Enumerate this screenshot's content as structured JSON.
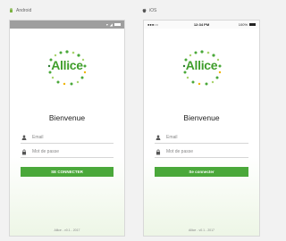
{
  "platforms": {
    "android_label": "Android",
    "ios_label": "iOS"
  },
  "ios_status": {
    "carrier": "",
    "time": "12:34 PM",
    "battery": "100%"
  },
  "app": {
    "logo_text": "Allice",
    "title": "Bienvenue",
    "email_placeholder": "Email",
    "password_placeholder": "Mot de passe",
    "android_button": "SE CONNECTER",
    "ios_button": "Se connecter",
    "footer": "Allice - v0.1 - 2017"
  },
  "colors": {
    "brand_green": "#4aa83a",
    "logo_green": "#3f9e2b"
  },
  "icons": {
    "android_logo": "android-icon",
    "apple_logo": "apple-icon",
    "user": "user-icon",
    "lock": "lock-icon"
  }
}
